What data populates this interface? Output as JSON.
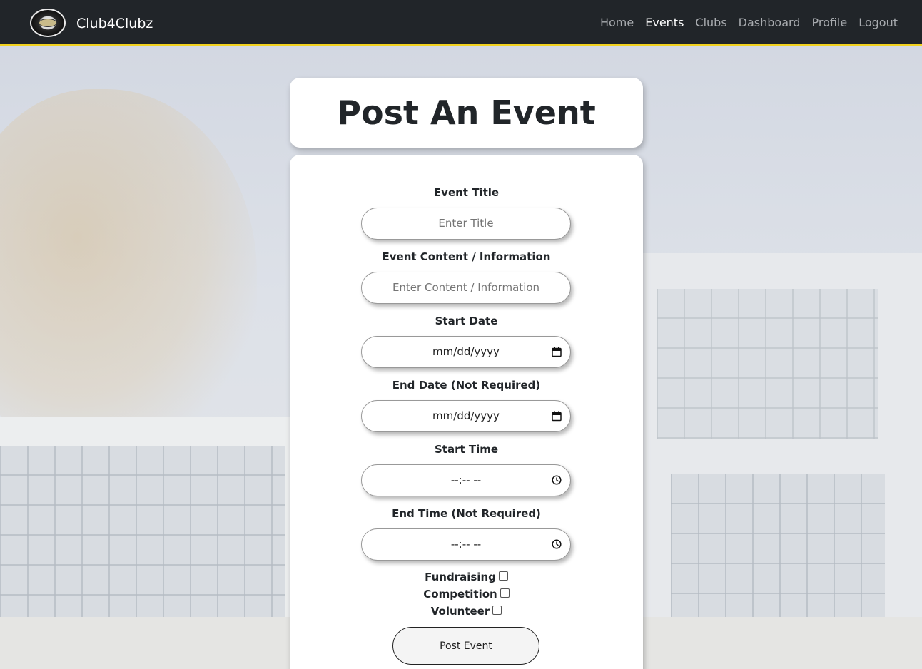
{
  "navbar": {
    "brand": "Club4Clubz",
    "links": [
      "Home",
      "Events",
      "Clubs",
      "Dashboard",
      "Profile",
      "Logout"
    ],
    "active": "Events",
    "accent_color": "#f2d21f",
    "background_color": "#212529"
  },
  "page": {
    "title": "Post An Event"
  },
  "form": {
    "event_title": {
      "label": "Event Title",
      "placeholder": "Enter Title"
    },
    "event_content": {
      "label": "Event Content / Information",
      "placeholder": "Enter Content / Information"
    },
    "start_date": {
      "label": "Start Date",
      "value": "mm/dd/yyyy",
      "icon": "calendar-icon"
    },
    "end_date": {
      "label": "End Date (Not Required)",
      "value": "mm/dd/yyyy",
      "icon": "calendar-icon"
    },
    "start_time": {
      "label": "Start Time",
      "value": "--:-- --",
      "icon": "clock-icon"
    },
    "end_time": {
      "label": "End Time (Not Required)",
      "value": "--:-- --",
      "icon": "clock-icon"
    },
    "categories": [
      "Fundraising",
      "Competition",
      "Volunteer"
    ],
    "submit_label": "Post Event"
  }
}
